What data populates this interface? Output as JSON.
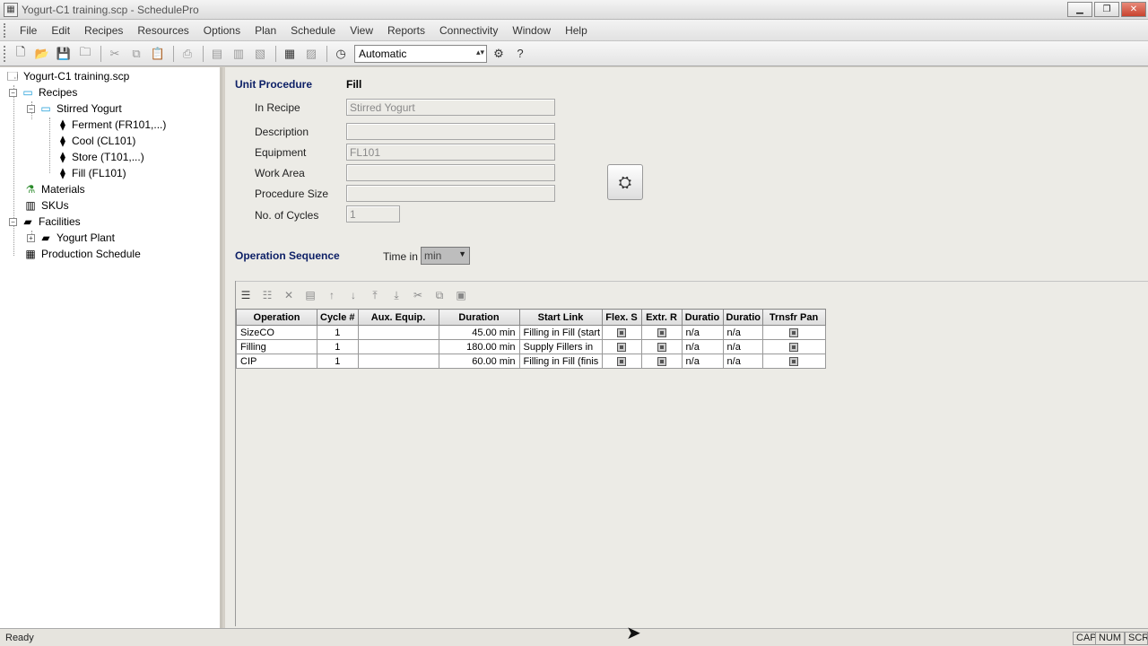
{
  "window": {
    "title": "Yogurt-C1 training.scp - SchedulePro",
    "app_icon": "schedulepro-app-icon"
  },
  "menu": [
    "File",
    "Edit",
    "Recipes",
    "Resources",
    "Options",
    "Plan",
    "Schedule",
    "View",
    "Reports",
    "Connectivity",
    "Window",
    "Help"
  ],
  "toolbar": {
    "mode_value": "Automatic"
  },
  "tree": {
    "file": "Yogurt-C1 training.scp",
    "recipes": "Recipes",
    "recipe": "Stirred Yogurt",
    "procedures": [
      "Ferment (FR101,...)",
      "Cool (CL101)",
      "Store (T101,...)",
      "Fill (FL101)"
    ],
    "materials": "Materials",
    "skus": "SKUs",
    "facilities": "Facilities",
    "plant": "Yogurt Plant",
    "schedule": "Production Schedule"
  },
  "unit_procedure": {
    "header": "Unit Procedure",
    "name": "Fill",
    "fields": {
      "in_recipe_label": "In Recipe",
      "in_recipe_value": "Stirred Yogurt",
      "description_label": "Description",
      "description_value": "",
      "equipment_label": "Equipment",
      "equipment_value": "FL101",
      "work_area_label": "Work Area",
      "work_area_value": "",
      "procedure_size_label": "Procedure Size",
      "procedure_size_value": "",
      "cycles_label": "No. of Cycles",
      "cycles_value": "1"
    }
  },
  "operation_sequence": {
    "header": "Operation Sequence",
    "time_in_label": "Time in",
    "time_unit": "min",
    "columns": [
      "Operation",
      "Cycle #",
      "Aux. Equip.",
      "Duration",
      "Start Link",
      "Flex. S",
      "Extr. R",
      "Duratio",
      "Duratio",
      "Trnsfr Pan"
    ],
    "rows": [
      {
        "operation": "SizeCO",
        "cycle": "1",
        "aux": "",
        "duration": "45.00 min",
        "start_link": "Filling in Fill (start",
        "dur_a": "n/a",
        "dur_b": "n/a"
      },
      {
        "operation": "Filling",
        "cycle": "1",
        "aux": "",
        "duration": "180.00 min",
        "start_link": "Supply Fillers in",
        "dur_a": "n/a",
        "dur_b": "n/a"
      },
      {
        "operation": "CIP",
        "cycle": "1",
        "aux": "",
        "duration": "60.00 min",
        "start_link": "Filling in Fill (finis",
        "dur_a": "n/a",
        "dur_b": "n/a"
      }
    ]
  },
  "status": {
    "text": "Ready",
    "cap": "CAP",
    "num": "NUM",
    "scrl": "SCRL"
  }
}
